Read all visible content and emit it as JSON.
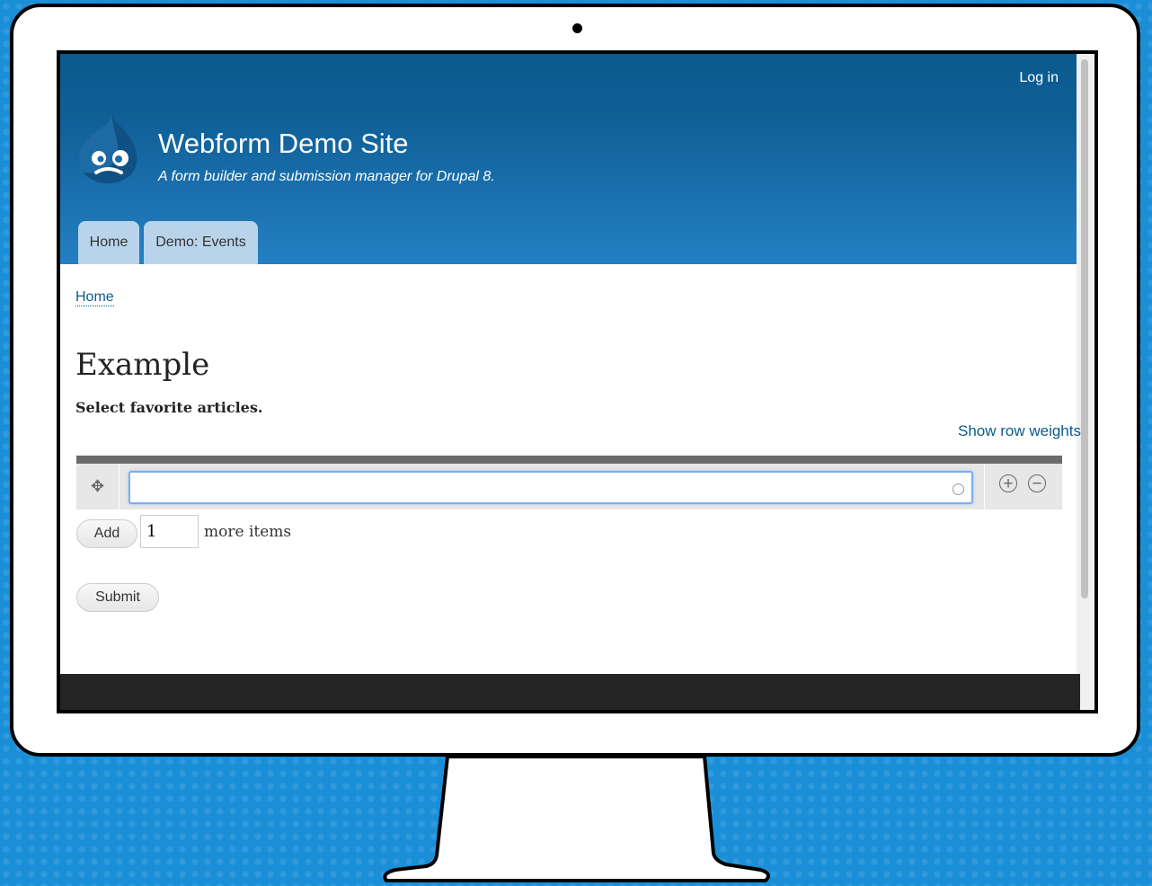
{
  "header": {
    "login_label": "Log in",
    "site_name": "Webform Demo Site",
    "slogan": "A form builder and submission manager for Drupal 8.",
    "logo_icon": "drupal-drop-icon",
    "tabs": [
      {
        "label": "Home"
      },
      {
        "label": "Demo: Events"
      }
    ]
  },
  "breadcrumb": {
    "home_label": "Home"
  },
  "page": {
    "title": "Example",
    "description": "Select favorite articles.",
    "show_row_weights_label": "Show row weights"
  },
  "multiple": {
    "row_input_value": "",
    "add_button_label": "Add",
    "more_count_value": "1",
    "more_items_label": "more items",
    "drag_icon": "move-arrows-icon",
    "add_row_icon": "plus-circle-icon",
    "remove_row_icon": "minus-circle-icon"
  },
  "form": {
    "submit_label": "Submit"
  },
  "colors": {
    "header_top": "#0b5a8d",
    "header_bottom": "#2480c3",
    "tab_bg": "#b9d4ea",
    "link": "#0b5a8d",
    "footer": "#252525",
    "background": "#1a8fd8"
  }
}
